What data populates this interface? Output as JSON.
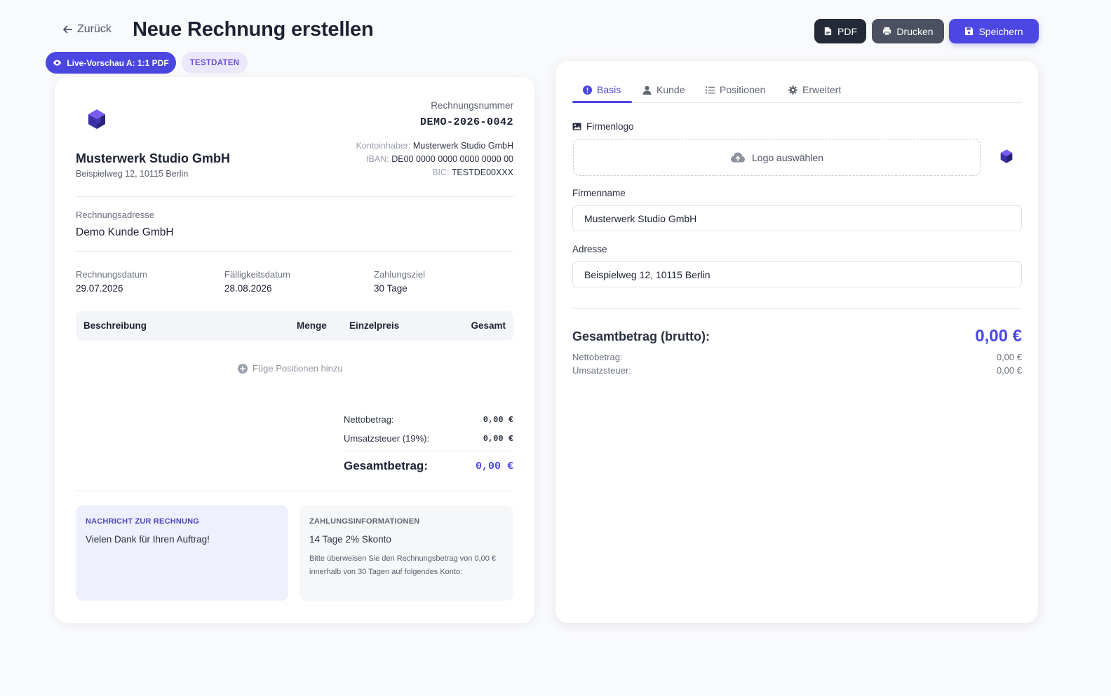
{
  "header": {
    "back_label": "Zurück",
    "title": "Neue Rechnung erstellen",
    "buttons": {
      "pdf": "PDF",
      "print": "Drucken",
      "save": "Speichern"
    },
    "badges": {
      "live_preview": "Live-Vorschau A: 1:1 PDF",
      "test_data": "TESTDATEN"
    }
  },
  "preview": {
    "invoice_number_label": "Rechnungsnummer",
    "invoice_number": "DEMO-2026-0042",
    "company_name": "Musterwerk Studio GmbH",
    "company_address": "Beispielweg 12, 10115 Berlin",
    "bank": {
      "holder_label": "Kontoinhaber:",
      "holder": "Musterwerk Studio GmbH",
      "iban_label": "IBAN:",
      "iban": "DE00 0000 0000 0000 0000 00",
      "bic_label": "BIC:",
      "bic": "TESTDE00XXX"
    },
    "billing_label": "Rechnungsadresse",
    "billing_name": "Demo Kunde GmbH",
    "dates": {
      "invoice_date_label": "Rechnungsdatum",
      "invoice_date": "29.07.2026",
      "due_date_label": "Fälligkeitsdatum",
      "due_date": "28.08.2026",
      "terms_label": "Zahlungsziel",
      "terms": "30 Tage"
    },
    "table": {
      "columns": [
        "Beschreibung",
        "Menge",
        "Einzelpreis",
        "Gesamt"
      ],
      "add_label": "Füge Positionen hinzu"
    },
    "summary": {
      "net_label": "Nettobetrag:",
      "net": "0,00 €",
      "vat_label": "Umsatzsteuer (19%):",
      "vat": "0,00 €",
      "total_label": "Gesamtbetrag:",
      "total": "0,00 €"
    },
    "message": {
      "title": "NACHRICHT ZUR RECHNUNG",
      "text": "Vielen Dank für Ihren Auftrag!"
    },
    "payment": {
      "title": "ZAHLUNGSINFORMATIONEN",
      "headline": "14 Tage 2% Skonto",
      "text": "Bitte überweisen Sie den Rechnungsbetrag von 0,00 € innerhalb von 30 Tagen auf folgendes Konto:"
    }
  },
  "form": {
    "tabs": [
      {
        "label": "Basis",
        "active": true
      },
      {
        "label": "Kunde",
        "active": false
      },
      {
        "label": "Positionen",
        "active": false
      },
      {
        "label": "Erweitert",
        "active": false
      }
    ],
    "logo_label": "Firmenlogo",
    "logo_button": "Logo auswählen",
    "company_name_label": "Firmenname",
    "company_name_value": "Musterwerk Studio GmbH",
    "address_label": "Adresse",
    "address_value": "Beispielweg 12, 10115 Berlin",
    "totals": {
      "gross_label": "Gesamtbetrag (brutto):",
      "gross": "0,00 €",
      "net_label": "Nettobetrag:",
      "net": "0,00 €",
      "vat_label": "Umsatzsteuer:",
      "vat": "0,00 €"
    }
  },
  "colors": {
    "accent": "#4c47e3",
    "dark_button": "#242a37",
    "gray_button": "#4b5161"
  },
  "icons": {
    "back": "arrow-left-icon",
    "pdf": "file-pdf-icon",
    "print": "printer-icon",
    "save": "floppy-disk-icon",
    "live": "eye-icon",
    "logo": "cube-icon",
    "add": "plus-circle-icon",
    "tab_basis": "info-circle-icon",
    "tab_kunde": "user-icon",
    "tab_positionen": "list-icon",
    "tab_erweitert": "gear-icon",
    "image": "image-icon",
    "upload": "cloud-upload-icon"
  }
}
